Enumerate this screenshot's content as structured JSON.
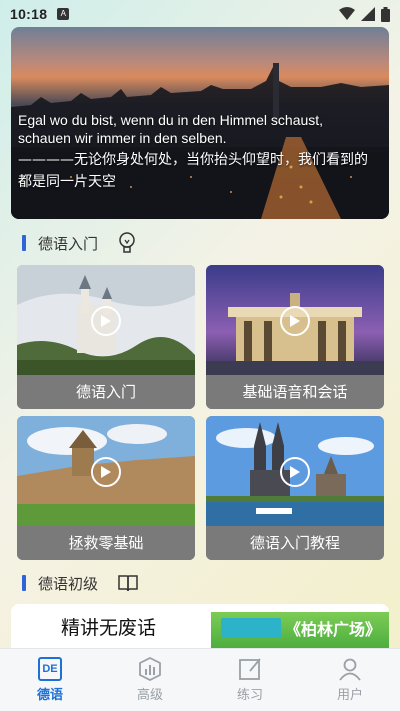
{
  "status_bar": {
    "time": "10:18",
    "notification_icon": "a-letter-icon",
    "icons": [
      "wifi-icon",
      "signal-icon",
      "battery-icon"
    ]
  },
  "banner": {
    "german_quote": "Egal wo du bist, wenn du in den Himmel schaust, schauen wir immer in den selben.",
    "chinese_quote": "————无论你身处何处，当你抬头仰望时，我们看到的都是同一片天空"
  },
  "section_intro": {
    "title": "德语入门",
    "icon": "lightbulb-icon"
  },
  "courses": [
    {
      "title": "德语入门",
      "image": "castle-mist-photo"
    },
    {
      "title": "基础语音和会话",
      "image": "brandenburg-gate-photo"
    },
    {
      "title": "拯救零基础",
      "image": "zwinger-palace-photo"
    },
    {
      "title": "德语入门教程",
      "image": "cologne-cathedral-photo"
    }
  ],
  "section_beginner": {
    "title": "德语初级",
    "icon": "book-icon"
  },
  "promo": {
    "left_text": "精讲无废话",
    "book_title": "《柏林广场》"
  },
  "tabs": [
    {
      "label": "德语",
      "icon": "de-badge-icon",
      "badge_text": "DE",
      "active": true
    },
    {
      "label": "高级",
      "icon": "chart-icon",
      "active": false
    },
    {
      "label": "练习",
      "icon": "edit-note-icon",
      "active": false
    },
    {
      "label": "用户",
      "icon": "user-icon",
      "active": false
    }
  ],
  "colors": {
    "accent": "#1e6fd6",
    "section_bar": "#2f64d8",
    "tab_inactive": "#9aa0a6",
    "caption_bg": "#7a7a7a"
  }
}
